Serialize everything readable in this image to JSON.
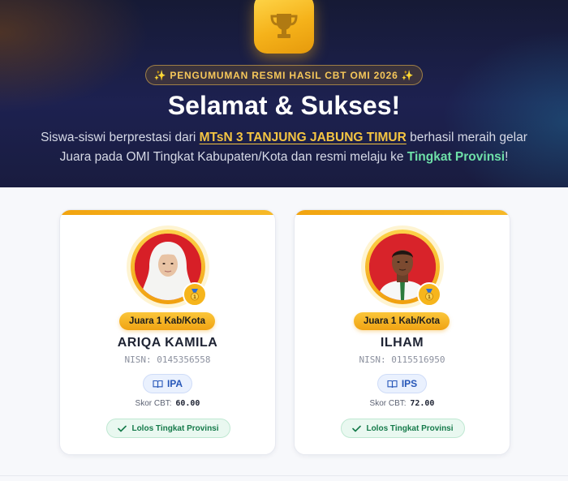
{
  "hero": {
    "badge": "✨ PENGUMUMAN RESMI HASIL CBT OMI 2026 ✨",
    "title": "Selamat & Sukses!",
    "desc_prefix": "Siswa-siswi berprestasi dari ",
    "school": "MTsN 3 TANJUNG JABUNG TIMUR",
    "desc_middle": " berhasil meraih gelar Juara pada OMI Tingkat Kabupaten/Kota dan resmi melaju ke ",
    "level": "Tingkat Provinsi",
    "desc_suffix": "!"
  },
  "students": [
    {
      "rank": "Juara 1 Kab/Kota",
      "name": "ARIQA KAMILA",
      "nisn": "NISN: 0145356558",
      "subject": "IPA",
      "score_label": "Skor CBT:",
      "score": "60.00",
      "status": "Lolos Tingkat Provinsi"
    },
    {
      "rank": "Juara 1 Kab/Kota",
      "name": "ILHAM",
      "nisn": "NISN: 0115516950",
      "subject": "IPS",
      "score_label": "Skor CBT:",
      "score": "72.00",
      "status": "Lolos Tingkat Provinsi"
    }
  ],
  "icons": {
    "trophy": "trophy-icon",
    "medal": "medal-icon",
    "book": "book-icon",
    "check": "check-icon"
  },
  "colors": {
    "accent": "#f5b21a",
    "hero_bg": "#1d2150",
    "success": "#157a4a",
    "subject": "#2757b8"
  }
}
